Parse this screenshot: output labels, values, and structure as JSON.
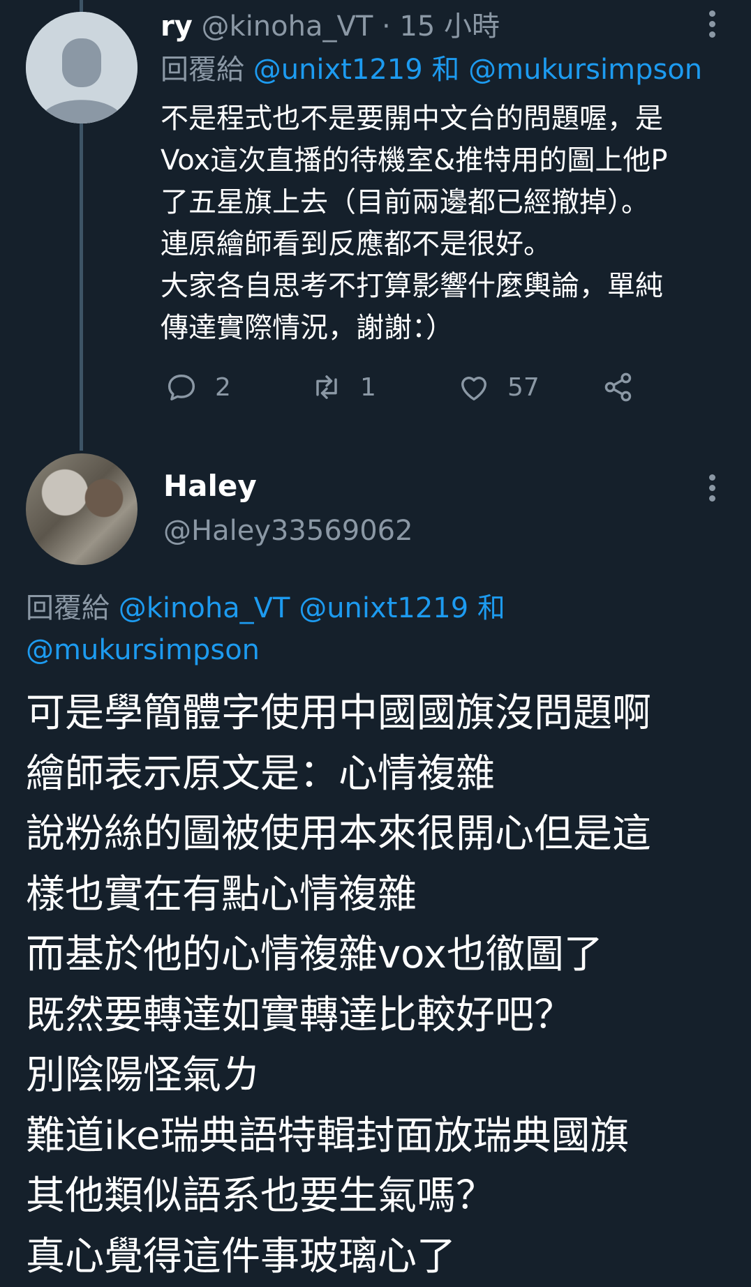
{
  "tweet1": {
    "name": "ry",
    "handle": "@kinoha_VT",
    "time": "· 15 小時",
    "reply_prefix": "回覆給",
    "reply_user1": "@unixt1219",
    "reply_and": "和",
    "reply_user2": "@mukursimpson",
    "lines": [
      "不是程式也不是要開中文台的問題喔，是",
      "Vox這次直播的待機室&推特用的圖上他P",
      "了五星旗上去（目前兩邊都已經撤掉）。",
      "連原繪師看到反應都不是很好。",
      "大家各自思考不打算影響什麼輿論，單純",
      "傳達實際情況，謝謝：）"
    ],
    "actions": {
      "replies": "2",
      "retweets": "1",
      "likes": "57"
    },
    "icons": [
      "reply-icon",
      "retweet-icon",
      "like-icon",
      "share-icon",
      "more-icon"
    ]
  },
  "tweet2": {
    "name": "Haley",
    "handle": "@Haley33569062",
    "reply_prefix": "回覆給",
    "reply_user1": "@kinoha_VT",
    "reply_user2": "@unixt1219",
    "reply_and": "和",
    "reply_user3": "@mukursimpson",
    "lines": [
      "可是學簡體字使用中國國旗沒問題啊",
      "繪師表示原文是：心情複雜",
      "說粉絲的圖被使用本來很開心但是這",
      "樣也實在有點心情複雜",
      "而基於他的心情複雜vox也徹圖了",
      "既然要轉達如實轉達比較好吧？",
      "別陰陽怪氣ㄌ",
      "難道ike瑞典語特輯封面放瑞典國旗",
      "其他類似語系也要生氣嗎？",
      "真心覺得這件事玻璃心了"
    ]
  },
  "colors": {
    "background": "#15202b",
    "muted": "#8b98a5",
    "link": "#1d9bf0",
    "thread": "#3d5466"
  }
}
